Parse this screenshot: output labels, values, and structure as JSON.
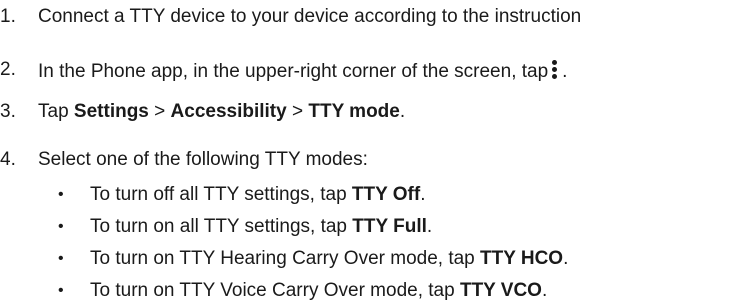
{
  "steps": [
    {
      "number": "1.",
      "text": "Connect a TTY device to your device according to the instruction"
    },
    {
      "number": "2.",
      "text_before": "In the Phone app, in the upper-right corner of the screen, tap",
      "icon": "more-options-icon",
      "text_after": "."
    },
    {
      "number": "3.",
      "text_before": "Tap ",
      "bold1": "Settings",
      "sep1": " > ",
      "bold2": "Accessibility",
      "sep2": " > ",
      "bold3": "TTY mode",
      "text_after": "."
    },
    {
      "number": "4.",
      "text": "Select one of the following TTY modes:"
    }
  ],
  "bullets": [
    {
      "symbol": "•",
      "text_before": "To turn off all TTY settings, tap ",
      "bold": "TTY Off",
      "text_after": "."
    },
    {
      "symbol": "•",
      "text_before": "To turn on all TTY settings, tap ",
      "bold": "TTY Full",
      "text_after": "."
    },
    {
      "symbol": "•",
      "text_before": "To turn on TTY Hearing Carry Over mode, tap ",
      "bold": "TTY HCO",
      "text_after": "."
    },
    {
      "symbol": "•",
      "text_before": "To turn on TTY Voice Carry Over mode, tap ",
      "bold": "TTY VCO",
      "text_after": "."
    }
  ]
}
